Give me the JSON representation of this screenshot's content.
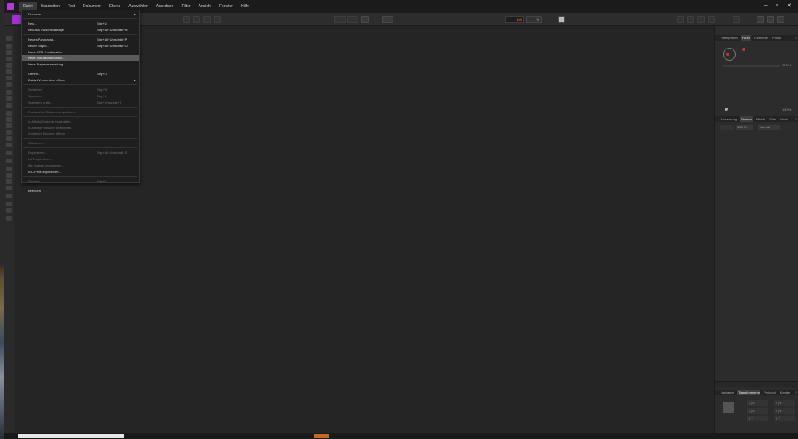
{
  "menubar": {
    "items": [
      "Datei",
      "Bearbeiten",
      "Text",
      "Dokument",
      "Ebene",
      "Auswählen",
      "Anordnen",
      "Filter",
      "Ansicht",
      "Fenster",
      "Hilfe"
    ],
    "active_index": 0,
    "window_controls": [
      "–",
      "▫",
      "✕"
    ]
  },
  "toolbar": {
    "zoom_value": "100",
    "zoom_unit": "%"
  },
  "file_menu": {
    "items": [
      {
        "label": "Personas",
        "shortcut": "",
        "submenu": true,
        "enabled": true
      },
      {
        "label": "Neu...",
        "shortcut": "Strg+N",
        "submenu": false,
        "enabled": true
      },
      {
        "label": "Neu aus Zwischenablage",
        "shortcut": "Strg+Alt+Umschalt+N",
        "submenu": false,
        "enabled": true
      },
      {
        "label": "Neues Panorama...",
        "shortcut": "Strg+Alt+Umschalt+P",
        "submenu": false,
        "enabled": true
      },
      {
        "label": "Neuer Stapel...",
        "shortcut": "Strg+Alt+Umschalt+O",
        "submenu": false,
        "enabled": true
      },
      {
        "label": "Neue HDR-Kombination...",
        "shortcut": "",
        "submenu": false,
        "enabled": true
      },
      {
        "label": "Neue Fokuskombination...",
        "shortcut": "",
        "submenu": false,
        "enabled": true,
        "highlighted": true
      },
      {
        "label": "Neue Stapelverarbeitung...",
        "shortcut": "",
        "submenu": false,
        "enabled": true
      },
      {
        "label": "Öffnen...",
        "shortcut": "Strg+O",
        "submenu": false,
        "enabled": true
      },
      {
        "label": "Zuletzt Verwendete öffnen",
        "shortcut": "",
        "submenu": true,
        "enabled": true
      },
      {
        "label": "Schließen",
        "shortcut": "Strg+W",
        "submenu": false,
        "enabled": false
      },
      {
        "label": "Speichern",
        "shortcut": "Strg+S",
        "submenu": false,
        "enabled": false
      },
      {
        "label": "Speichern unter...",
        "shortcut": "Strg+Umschalt+S",
        "submenu": false,
        "enabled": false
      },
      {
        "label": "Protokoll mit Dokument speichern",
        "shortcut": "",
        "submenu": false,
        "enabled": false
      },
      {
        "label": "In Affinity Designer bearbeiten...",
        "shortcut": "",
        "submenu": false,
        "enabled": false
      },
      {
        "label": "In Affinity Publisher bearbeiten...",
        "shortcut": "",
        "submenu": false,
        "enabled": false
      },
      {
        "label": "Ordner im Explorer öffnen",
        "shortcut": "",
        "submenu": false,
        "enabled": false
      },
      {
        "label": "Platzieren...",
        "shortcut": "",
        "submenu": false,
        "enabled": false
      },
      {
        "label": "Exportieren...",
        "shortcut": "Strg+Alt+Umschalt+S",
        "submenu": false,
        "enabled": false
      },
      {
        "label": "LUT exportieren...",
        "shortcut": "",
        "submenu": false,
        "enabled": false
      },
      {
        "label": "Als Vorlage exportieren...",
        "shortcut": "",
        "submenu": false,
        "enabled": false
      },
      {
        "label": "ICC-Profil importieren...",
        "shortcut": "",
        "submenu": false,
        "enabled": true
      },
      {
        "label": "Drucken...",
        "shortcut": "Strg+P",
        "submenu": false,
        "enabled": false
      },
      {
        "label": "Beenden",
        "shortcut": "",
        "submenu": false,
        "enabled": true
      }
    ]
  },
  "panels": {
    "top": {
      "tabs": [
        "Histogramm",
        "Farbe",
        "Farbfelder",
        "Pinsel"
      ],
      "active": "Farbe",
      "opacity_value": "100 %",
      "bottom_value": "100 %"
    },
    "middle": {
      "tabs": [
        "Anpassung",
        "Ebenen",
        "Effekte",
        "Stile",
        "Stock"
      ],
      "active": "Ebenen",
      "opacity_value": "100 %",
      "blend_mode": "Normal"
    },
    "bottom": {
      "tabs": [
        "Navigator",
        "Transformieren",
        "Protokoll",
        "Kanäle"
      ],
      "active": "Transformieren",
      "fields": {
        "x": "0 px",
        "y": "0 px",
        "w": "0 px",
        "h": "0 px",
        "r": "0 °",
        "s": "0 °"
      }
    }
  },
  "colors": {
    "app_bg": "#252525",
    "menubar_bg": "#1b1b1b",
    "accent_purple": "#a22fd4",
    "zoom_text": "#ff7a3d",
    "highlight_row": "#5b5b5b"
  }
}
